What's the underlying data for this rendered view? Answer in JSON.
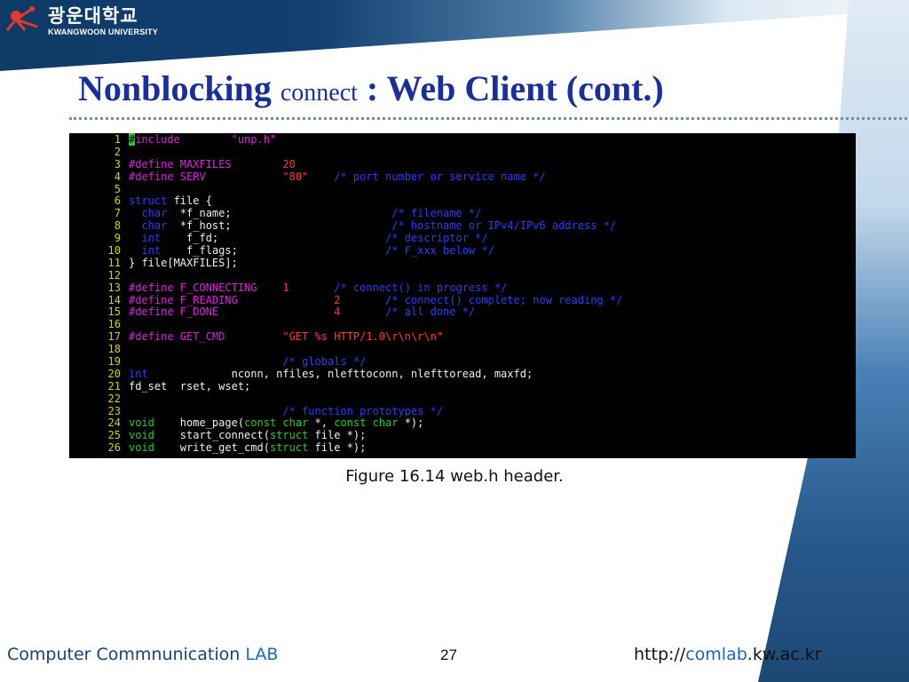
{
  "logo": {
    "korean": "광운대학교",
    "english": "KWANGWOON UNIVERSITY",
    "icon": "university-emblem-icon"
  },
  "title": {
    "part1": "Nonblocking",
    "part2": "connect",
    "part3": ": Web Client (cont.)"
  },
  "code": {
    "lines": [
      {
        "n": "1",
        "t": [
          [
            "cur",
            "#"
          ],
          [
            "mag",
            "include"
          ],
          [
            "",
            "        "
          ],
          [
            "mag",
            "\"unp.h\""
          ]
        ]
      },
      {
        "n": "2",
        "t": []
      },
      {
        "n": "3",
        "t": [
          [
            "mag",
            "#define MAXFILES"
          ],
          [
            "",
            "        "
          ],
          [
            "red",
            "20"
          ]
        ]
      },
      {
        "n": "4",
        "t": [
          [
            "mag",
            "#define SERV"
          ],
          [
            "",
            "            "
          ],
          [
            "red",
            "\"80\""
          ],
          [
            "",
            "    "
          ],
          [
            "blu",
            "/* port number or service name */"
          ]
        ]
      },
      {
        "n": "5",
        "t": []
      },
      {
        "n": "6",
        "t": [
          [
            "blu",
            "struct"
          ],
          [
            "src",
            " file {"
          ]
        ]
      },
      {
        "n": "7",
        "t": [
          [
            "src",
            "  "
          ],
          [
            "blu",
            "char"
          ],
          [
            "src",
            "  *f_name;"
          ],
          [
            "",
            "                         "
          ],
          [
            "blu",
            "/* filename */"
          ]
        ]
      },
      {
        "n": "8",
        "t": [
          [
            "src",
            "  "
          ],
          [
            "blu",
            "char"
          ],
          [
            "src",
            "  *f_host;"
          ],
          [
            "",
            "                         "
          ],
          [
            "blu",
            "/* hostname or IPv4/IPv6 address */"
          ]
        ]
      },
      {
        "n": "9",
        "t": [
          [
            "src",
            "  "
          ],
          [
            "blu",
            "int"
          ],
          [
            "src",
            "    f_fd;"
          ],
          [
            "",
            "                          "
          ],
          [
            "blu",
            "/* descriptor */"
          ]
        ]
      },
      {
        "n": "10",
        "t": [
          [
            "src",
            "  "
          ],
          [
            "blu",
            "int"
          ],
          [
            "src",
            "    f_flags;"
          ],
          [
            "",
            "                       "
          ],
          [
            "blu",
            "/* F_xxx below */"
          ]
        ]
      },
      {
        "n": "11",
        "t": [
          [
            "src",
            "} file[MAXFILES];"
          ]
        ]
      },
      {
        "n": "12",
        "t": []
      },
      {
        "n": "13",
        "t": [
          [
            "mag",
            "#define F_CONNECTING"
          ],
          [
            "",
            "    "
          ],
          [
            "red",
            "1"
          ],
          [
            "",
            "       "
          ],
          [
            "blu",
            "/* connect() in progress */"
          ]
        ]
      },
      {
        "n": "14",
        "t": [
          [
            "mag",
            "#define F_READING"
          ],
          [
            "",
            "               "
          ],
          [
            "red",
            "2"
          ],
          [
            "",
            "       "
          ],
          [
            "blu",
            "/* connect() complete; now reading */"
          ]
        ]
      },
      {
        "n": "15",
        "t": [
          [
            "mag",
            "#define F_DONE"
          ],
          [
            "",
            "                  "
          ],
          [
            "red",
            "4"
          ],
          [
            "",
            "       "
          ],
          [
            "blu",
            "/* all done */"
          ]
        ]
      },
      {
        "n": "16",
        "t": []
      },
      {
        "n": "17",
        "t": [
          [
            "mag",
            "#define GET_CMD"
          ],
          [
            "",
            "         "
          ],
          [
            "red",
            "\"GET %s HTTP/1.0\\r\\n\\r\\n\""
          ]
        ]
      },
      {
        "n": "18",
        "t": []
      },
      {
        "n": "19",
        "t": [
          [
            "",
            "                        "
          ],
          [
            "blu",
            "/* globals */"
          ]
        ]
      },
      {
        "n": "20",
        "t": [
          [
            "blu",
            "int"
          ],
          [
            "src",
            "             nconn, nfiles, nlefttoconn, nlefttoread, maxfd;"
          ]
        ]
      },
      {
        "n": "21",
        "t": [
          [
            "src",
            "fd_set  rset, wset;"
          ]
        ]
      },
      {
        "n": "22",
        "t": []
      },
      {
        "n": "23",
        "t": [
          [
            "",
            "                        "
          ],
          [
            "blu",
            "/* function prototypes */"
          ]
        ]
      },
      {
        "n": "24",
        "t": [
          [
            "grn",
            "void"
          ],
          [
            "src",
            "    home_page("
          ],
          [
            "grn",
            "const char"
          ],
          [
            "src",
            " *, "
          ],
          [
            "grn",
            "const char"
          ],
          [
            "src",
            " *);"
          ]
        ]
      },
      {
        "n": "25",
        "t": [
          [
            "grn",
            "void"
          ],
          [
            "src",
            "    start_connect("
          ],
          [
            "grn",
            "struct"
          ],
          [
            "src",
            " file *);"
          ]
        ]
      },
      {
        "n": "26",
        "t": [
          [
            "grn",
            "void"
          ],
          [
            "src",
            "    write_get_cmd("
          ],
          [
            "grn",
            "struct"
          ],
          [
            "src",
            " file *);"
          ]
        ]
      }
    ]
  },
  "caption": "Figure 16.14 web.h header.",
  "footer": {
    "left_main": "Computer Commnunication ",
    "left_lab": "LAB",
    "page": "27",
    "right_pre": "http://",
    "right_mid": "comlab",
    "right_post": ".kw.ac.kr"
  },
  "colors": {
    "title": "#1b2f9a",
    "header_band": "#0d3a66",
    "code_bg": "#000000",
    "keyword": "#2b3cff",
    "preprocessor": "#e020e0",
    "constant": "#ff3a3a",
    "type": "#1fd21f",
    "line_number": "#d4d400"
  }
}
